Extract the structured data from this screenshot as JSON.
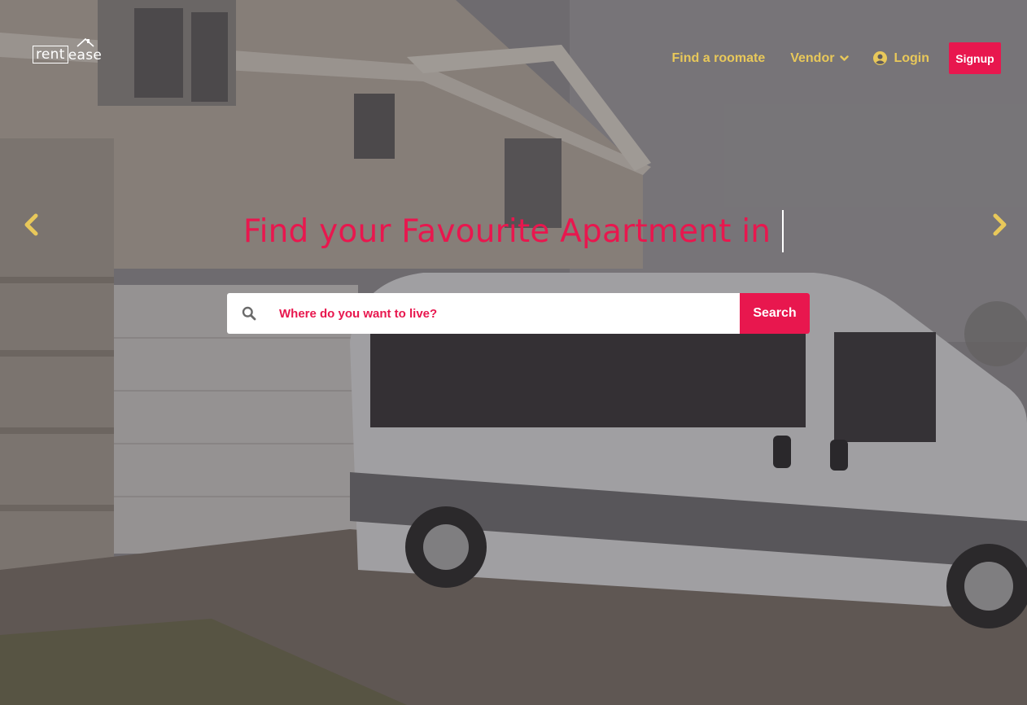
{
  "brand": {
    "logo_part1": "rent",
    "logo_part2": "ease"
  },
  "nav": {
    "find_roommate": "Find a roomate",
    "vendor": "Vendor",
    "login": "Login",
    "signup": "Signup"
  },
  "hero": {
    "heading": "Find your Favourite Apartment in",
    "prev_icon": "chevron-left-icon",
    "next_icon": "chevron-right-icon"
  },
  "search": {
    "placeholder": "Where do you want to live?",
    "button_label": "Search",
    "icon": "search-icon"
  },
  "colors": {
    "accent": "#e8174e",
    "nav_text": "#e8c85a",
    "text_light": "#ffffff"
  }
}
